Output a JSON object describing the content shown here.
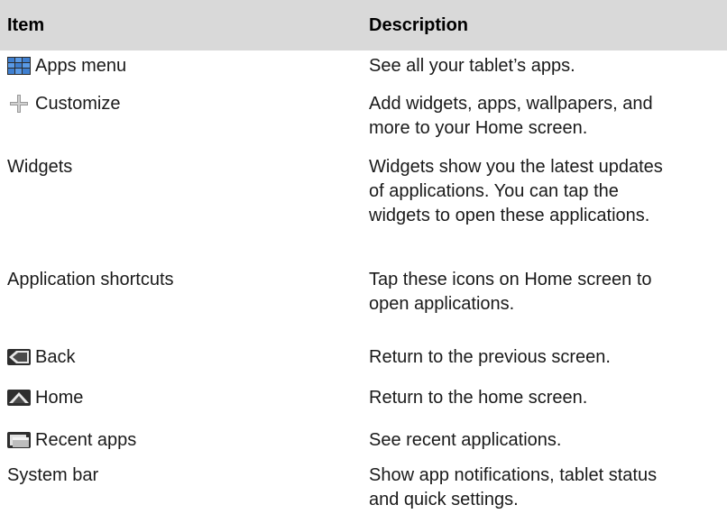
{
  "table": {
    "headers": {
      "item": "Item",
      "description": "Description"
    },
    "rows": [
      {
        "item": "Apps menu",
        "icon": "apps-grid-icon",
        "description": "See all your tablet’s apps."
      },
      {
        "item": "Customize",
        "icon": "plus-icon",
        "description": "Add widgets, apps, wallpapers, and more to your Home screen."
      },
      {
        "item": "Widgets",
        "icon": "",
        "description": "Widgets show you the latest updates of applications. You can tap the widgets to open these applications."
      },
      {
        "item": "Application shortcuts",
        "icon": "",
        "description": "Tap these icons on Home screen to open applications."
      },
      {
        "item": "Back",
        "icon": "back-icon",
        "description": "Return to the previous screen."
      },
      {
        "item": "Home",
        "icon": "home-icon",
        "description": "Return to the home screen."
      },
      {
        "item": "Recent apps",
        "icon": "recent-apps-icon",
        "description": "See recent applications."
      },
      {
        "item": "System bar",
        "icon": "",
        "description": "Show app notifications, tablet status and quick settings."
      }
    ]
  }
}
